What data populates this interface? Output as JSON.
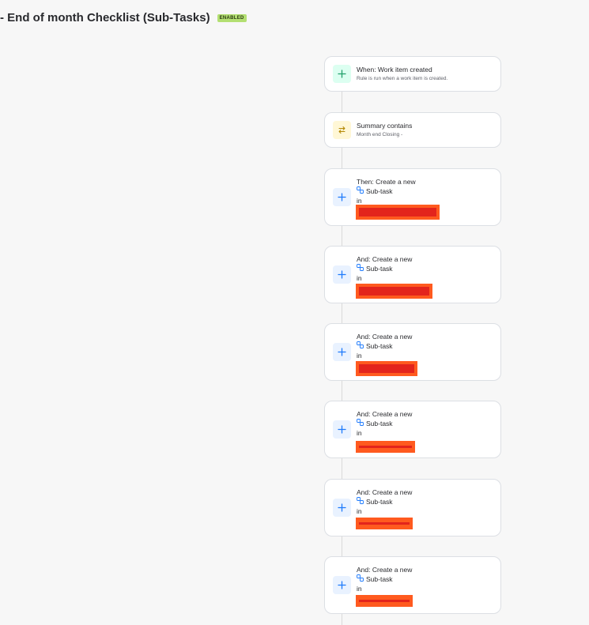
{
  "header": {
    "title": "- End of month Checklist (Sub-Tasks)",
    "badge": "ENABLED"
  },
  "trigger": {
    "title": "When: Work item created",
    "subtitle": "Rule is run when a work item is created.",
    "icon": "plus-icon"
  },
  "condition": {
    "title": "Summary contains",
    "subtitle": "Month end Closing -",
    "icon": "branch-arrows-icon"
  },
  "actions": [
    {
      "title": "Then: Create a new",
      "type": "Sub-task",
      "in_label": "in"
    },
    {
      "title": "And: Create a new",
      "type": "Sub-task",
      "in_label": "in"
    },
    {
      "title": "And: Create a new",
      "type": "Sub-task",
      "in_label": "in"
    },
    {
      "title": "And: Create a new",
      "type": "Sub-task",
      "in_label": "in"
    },
    {
      "title": "And: Create a new",
      "type": "Sub-task",
      "in_label": "in"
    },
    {
      "title": "And: Create a new",
      "type": "Sub-task",
      "in_label": "in"
    }
  ],
  "colors": {
    "badge": "#b3df72",
    "trigger_icon": "#22a06b",
    "condition_icon": "#b38600",
    "action_icon": "#1d7afc",
    "redaction": "#ff5a1f"
  }
}
